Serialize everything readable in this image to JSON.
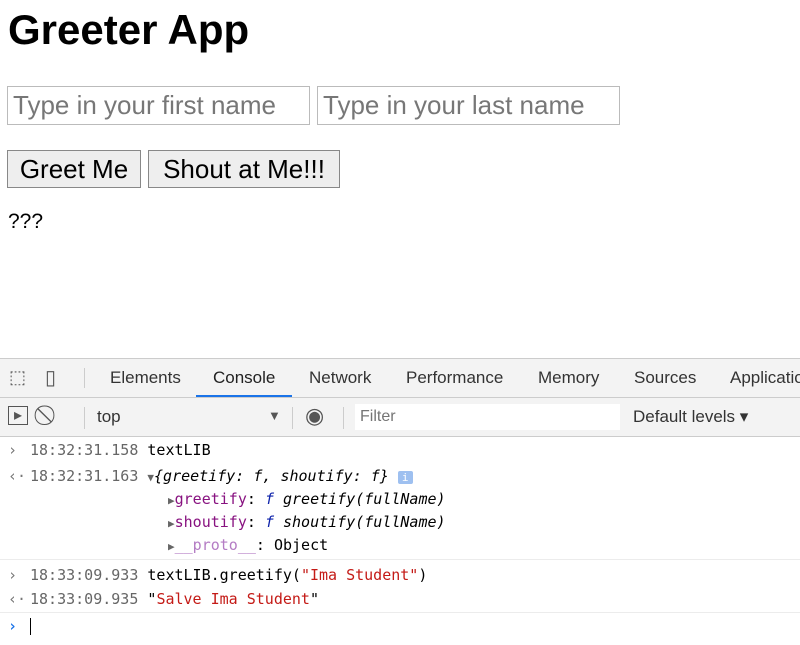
{
  "page": {
    "title": "Greeter App",
    "first_name_placeholder": "Type in your first name",
    "last_name_placeholder": "Type in your last name",
    "greet_button": "Greet Me",
    "shout_button": "Shout at Me!!!",
    "output": "???"
  },
  "devtools": {
    "tabs": [
      "Elements",
      "Console",
      "Network",
      "Performance",
      "Memory",
      "Sources",
      "Application"
    ],
    "active_tab": "Console",
    "context": "top",
    "filter_placeholder": "Filter",
    "levels": "Default levels ▾",
    "accent": "#1a73e8",
    "console": {
      "l1": {
        "ts": "18:32:31.158",
        "text": "textLIB"
      },
      "l2": {
        "ts": "18:32:31.163",
        "summary": "{greetify: f, shoutify: f}",
        "info": "i"
      },
      "p1": {
        "key": "greetify",
        "sep": ": ",
        "f": "f",
        "val": " greetify(fullName)"
      },
      "p2": {
        "key": "shoutify",
        "sep": ": ",
        "f": "f",
        "val": " shoutify(fullName)"
      },
      "p3": {
        "key": "__proto__",
        "val": ": Object"
      },
      "l3": {
        "ts": "18:33:09.933",
        "pre": "textLIB.greetify(",
        "arg": "\"Ima Student\"",
        "post": ")"
      },
      "l4": {
        "ts": "18:33:09.935",
        "q1": "\"",
        "str": "Salve Ima Student",
        "q2": "\""
      }
    }
  }
}
